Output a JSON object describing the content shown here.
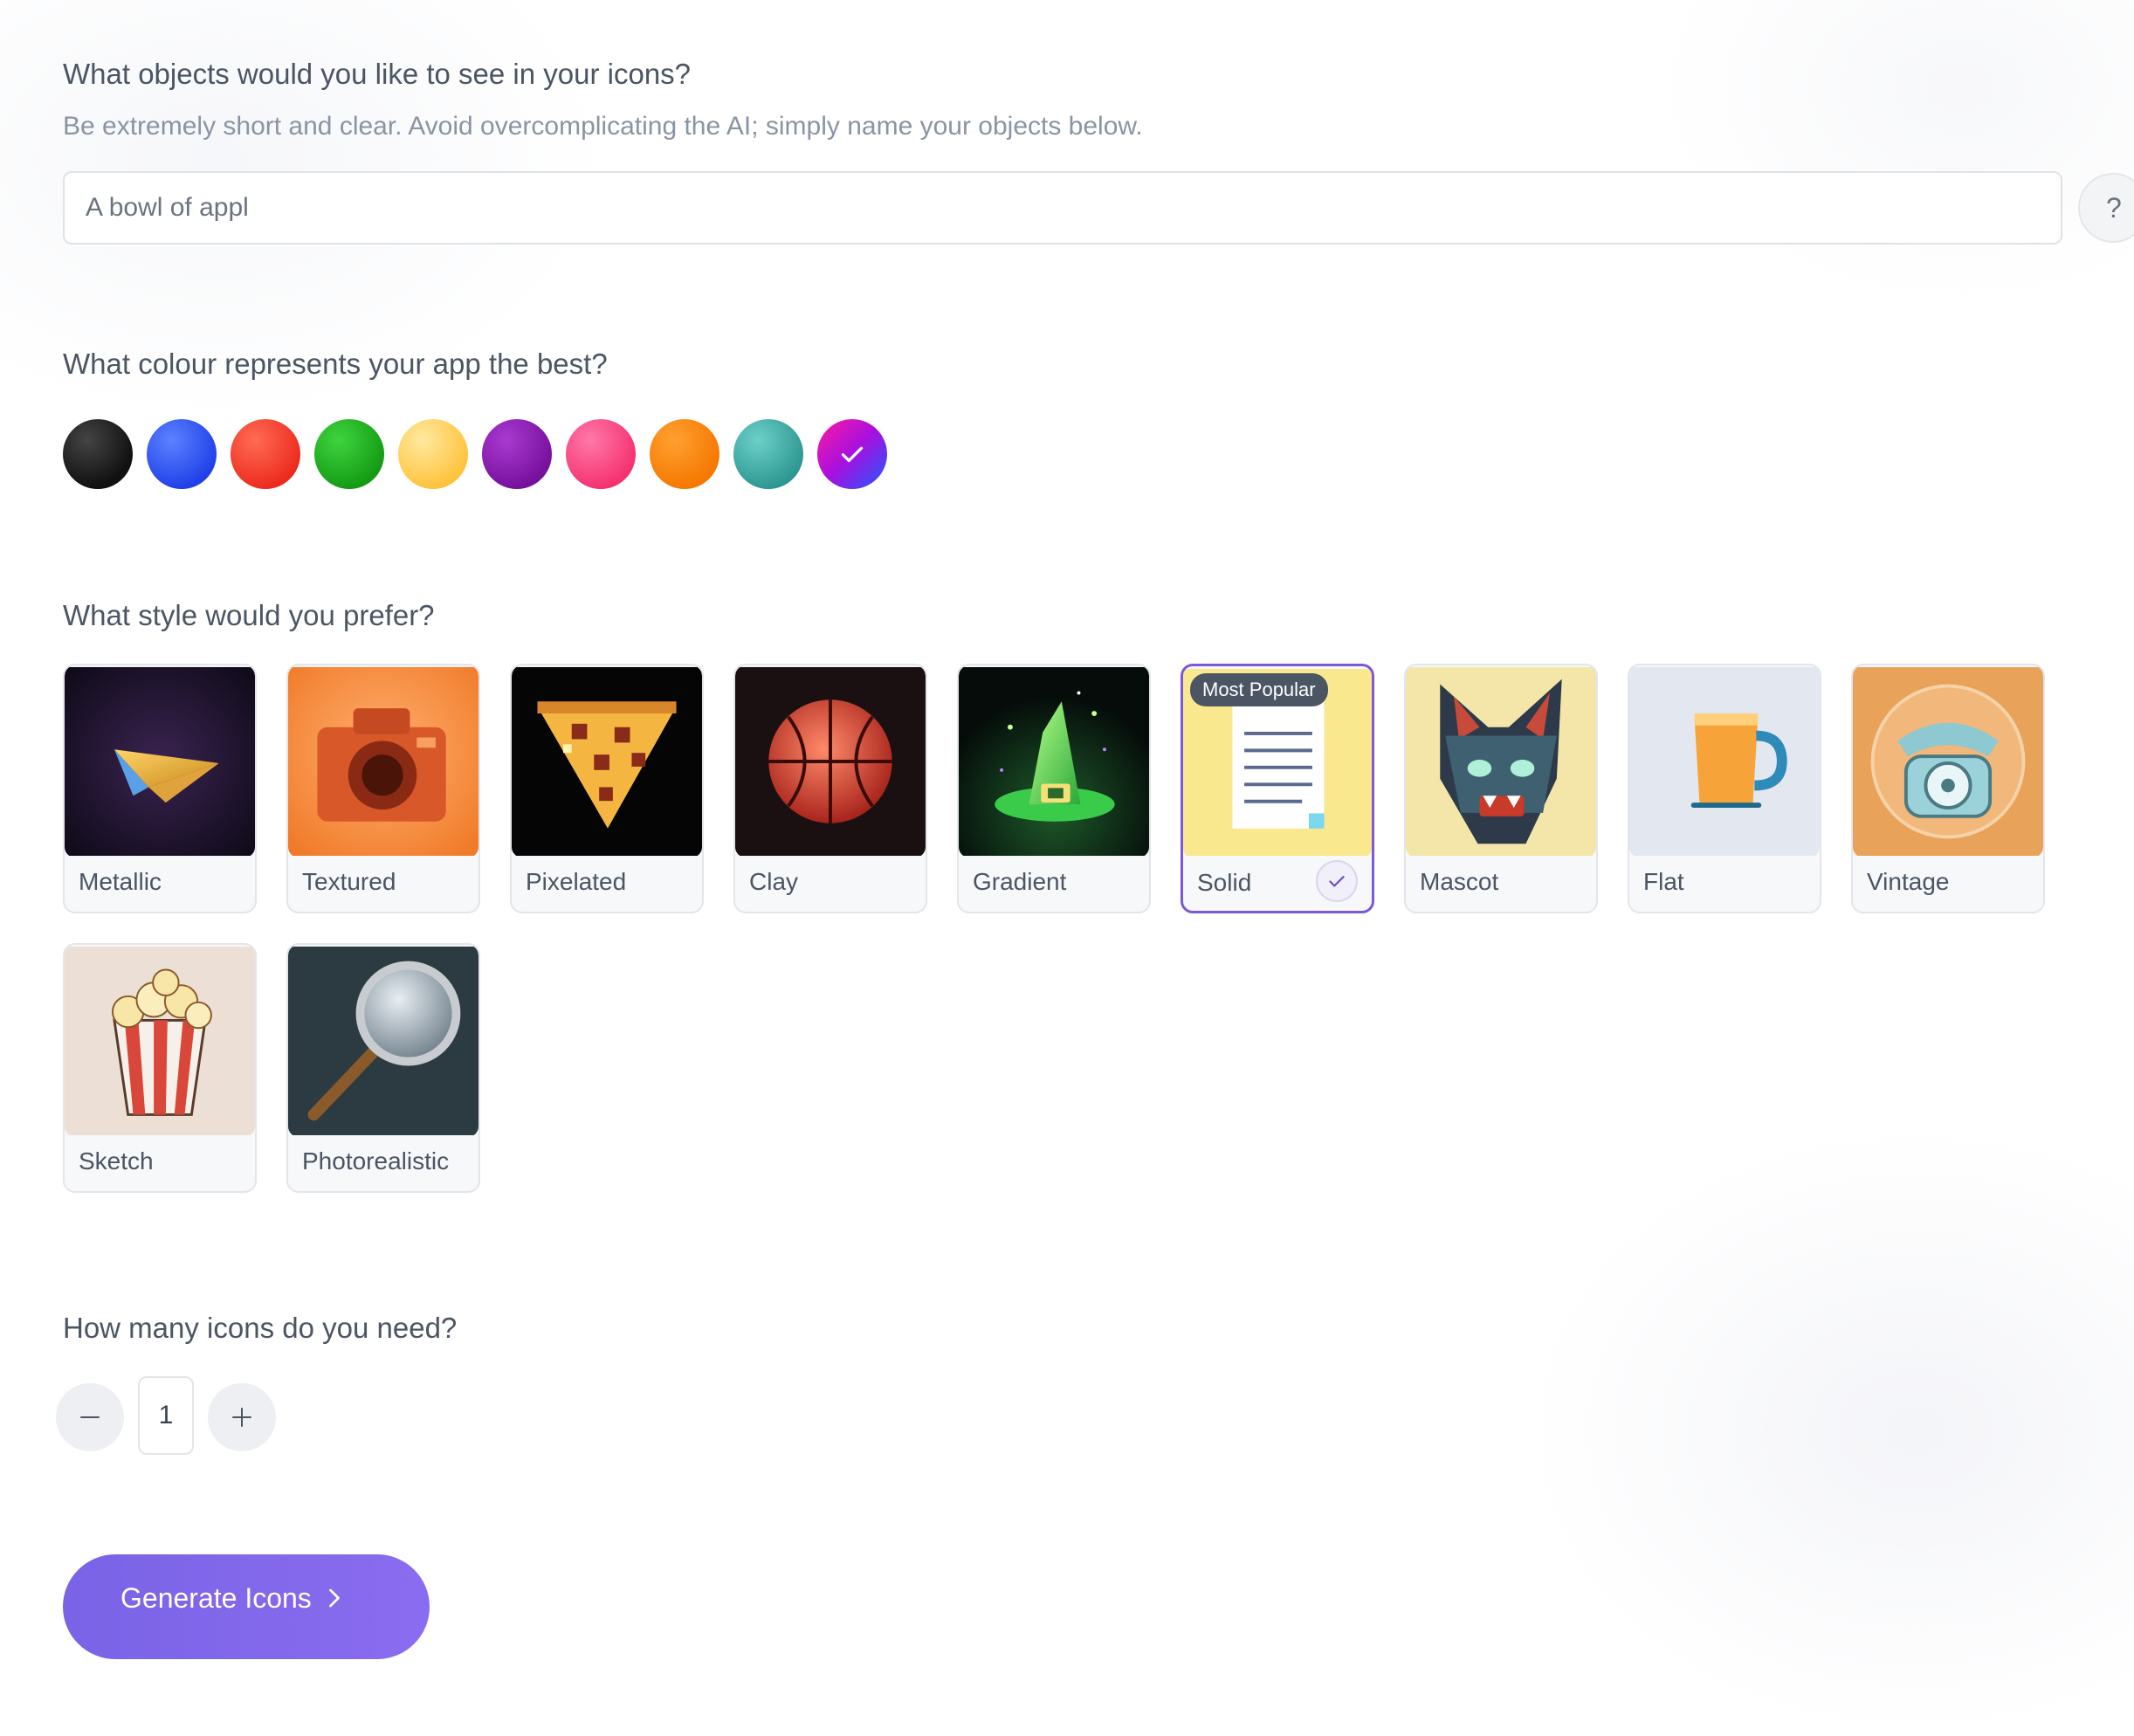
{
  "objects": {
    "question": "What objects would you like to see in your icons?",
    "hint": "Be extremely short and clear. Avoid overcomplicating the AI; simply name your objects below.",
    "input_value": "A bowl of appl",
    "help_label": "?"
  },
  "colour": {
    "question": "What colour represents your app the best?",
    "swatches": [
      {
        "name": "black",
        "color": "#1f1f1f",
        "selected": false
      },
      {
        "name": "blue",
        "color": "#2f55f5",
        "selected": false
      },
      {
        "name": "red",
        "color": "#f53a2a",
        "selected": false
      },
      {
        "name": "green",
        "color": "#1fb01f",
        "selected": false
      },
      {
        "name": "yellow",
        "color": "#ffd05a",
        "selected": false
      },
      {
        "name": "purple",
        "color": "#8a13b0",
        "selected": false
      },
      {
        "name": "pink",
        "color": "#fb3f86",
        "selected": false
      },
      {
        "name": "orange",
        "color": "#ff8200",
        "selected": false
      },
      {
        "name": "teal",
        "color": "#3aaaa3",
        "selected": false
      },
      {
        "name": "gradient",
        "color": "#d311d6",
        "selected": true
      }
    ]
  },
  "style": {
    "question": "What style would you prefer?",
    "badge": "Most Popular",
    "selected": "Solid",
    "options": [
      {
        "label": "Metallic",
        "icon": "paper-plane-icon"
      },
      {
        "label": "Textured",
        "icon": "camera-icon"
      },
      {
        "label": "Pixelated",
        "icon": "pizza-slice-icon"
      },
      {
        "label": "Clay",
        "icon": "basketball-icon"
      },
      {
        "label": "Gradient",
        "icon": "witch-hat-icon"
      },
      {
        "label": "Solid",
        "icon": "document-icon"
      },
      {
        "label": "Mascot",
        "icon": "wolf-icon"
      },
      {
        "label": "Flat",
        "icon": "mug-icon"
      },
      {
        "label": "Vintage",
        "icon": "telephone-icon"
      },
      {
        "label": "Sketch",
        "icon": "popcorn-icon"
      },
      {
        "label": "Photorealistic",
        "icon": "magnifier-icon"
      }
    ]
  },
  "count": {
    "question": "How many icons do you need?",
    "value": "1"
  },
  "generate": {
    "label": "Generate Icons"
  }
}
